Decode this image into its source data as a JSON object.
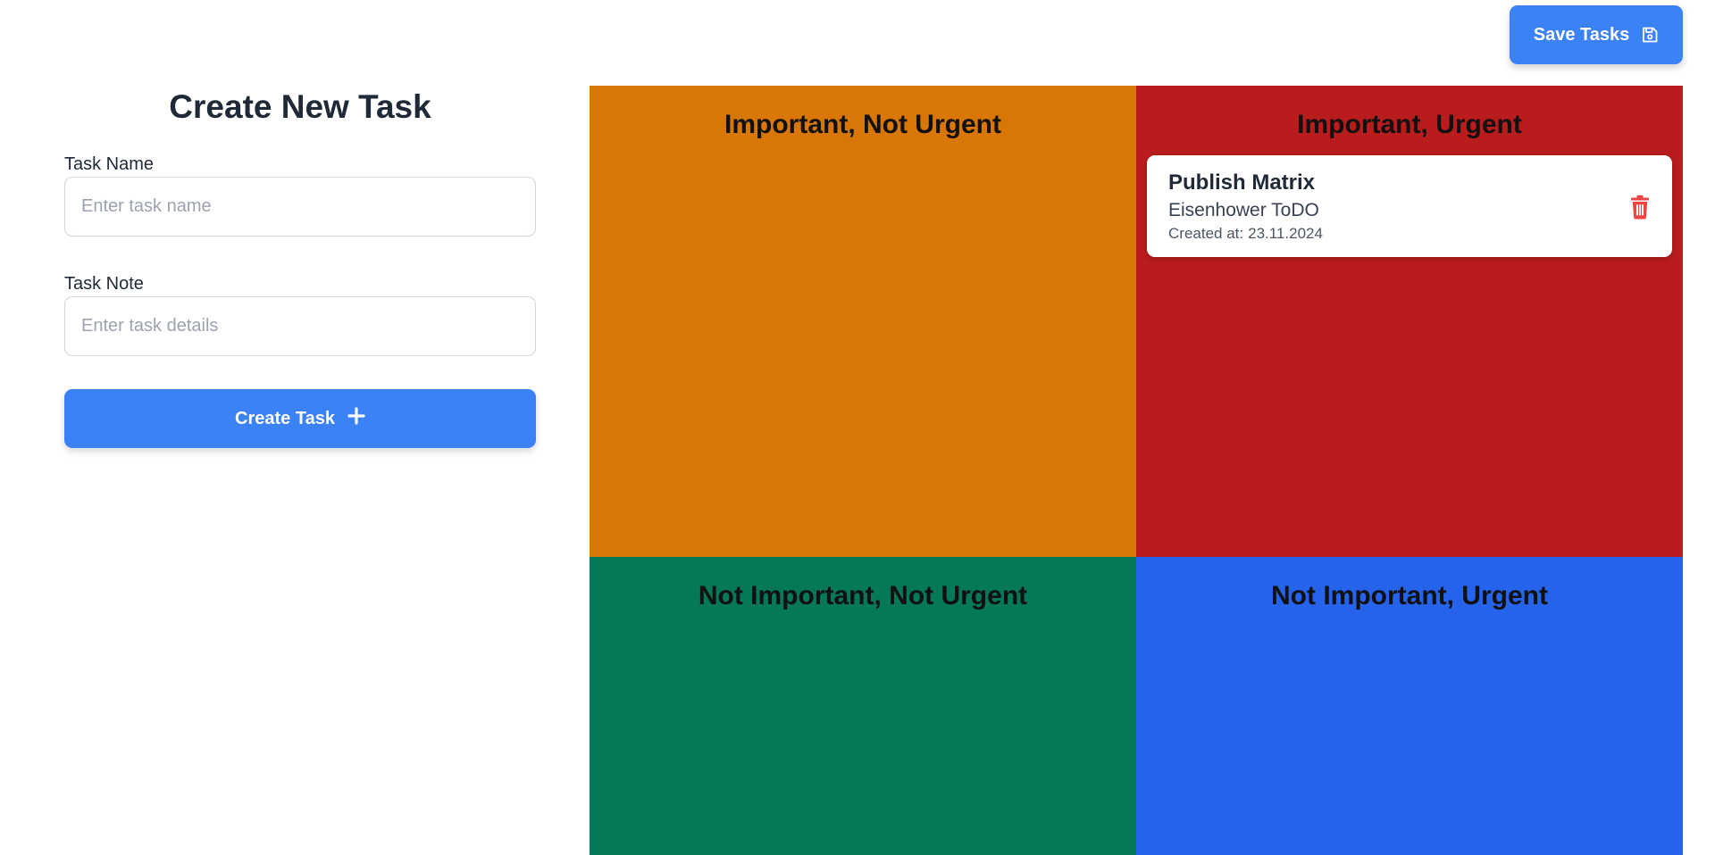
{
  "header": {
    "save_label": "Save Tasks",
    "save_icon": "floppy-disk-icon"
  },
  "form": {
    "title": "Create New Task",
    "task_name_label": "Task Name",
    "task_name_placeholder": "Enter task name",
    "task_name_value": "",
    "task_note_label": "Task Note",
    "task_note_placeholder": "Enter task details",
    "task_note_value": "",
    "create_label": "Create Task",
    "create_icon": "plus-icon"
  },
  "matrix": {
    "quadrants": [
      {
        "title": "Important, Not Urgent",
        "color": "#d97706"
      },
      {
        "title": "Important, Urgent",
        "color": "#b91c1c"
      },
      {
        "title": "Not Important, Not Urgent",
        "color": "#047857"
      },
      {
        "title": "Not Important, Urgent",
        "color": "#2563eb"
      }
    ],
    "tasks": [
      {
        "quadrant": "Important, Urgent",
        "name": "Publish Matrix",
        "note": "Eisenhower ToDO",
        "created_prefix": "Created at:",
        "created_at": "23.11.2024",
        "delete_icon": "trash-icon"
      }
    ]
  },
  "colors": {
    "accent": "#3b82f6",
    "delete": "#ef4444"
  }
}
